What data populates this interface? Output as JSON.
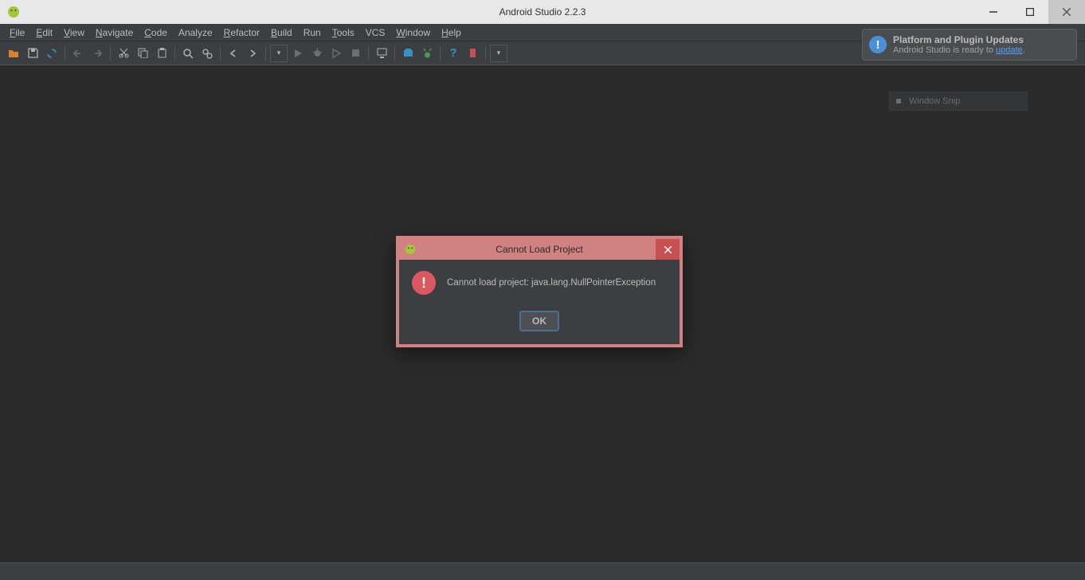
{
  "window": {
    "title": "Android Studio 2.2.3"
  },
  "menu": {
    "items": [
      "File",
      "Edit",
      "View",
      "Navigate",
      "Code",
      "Analyze",
      "Refactor",
      "Build",
      "Run",
      "Tools",
      "VCS",
      "Window",
      "Help"
    ]
  },
  "notification": {
    "title": "Platform and Plugin Updates",
    "prefix": "Android Studio is ready to ",
    "link": "update",
    "suffix": "."
  },
  "snip": {
    "label": "Window Snip"
  },
  "dialog": {
    "title": "Cannot Load Project",
    "message": "Cannot load project: java.lang.NullPointerException",
    "ok": "OK"
  }
}
